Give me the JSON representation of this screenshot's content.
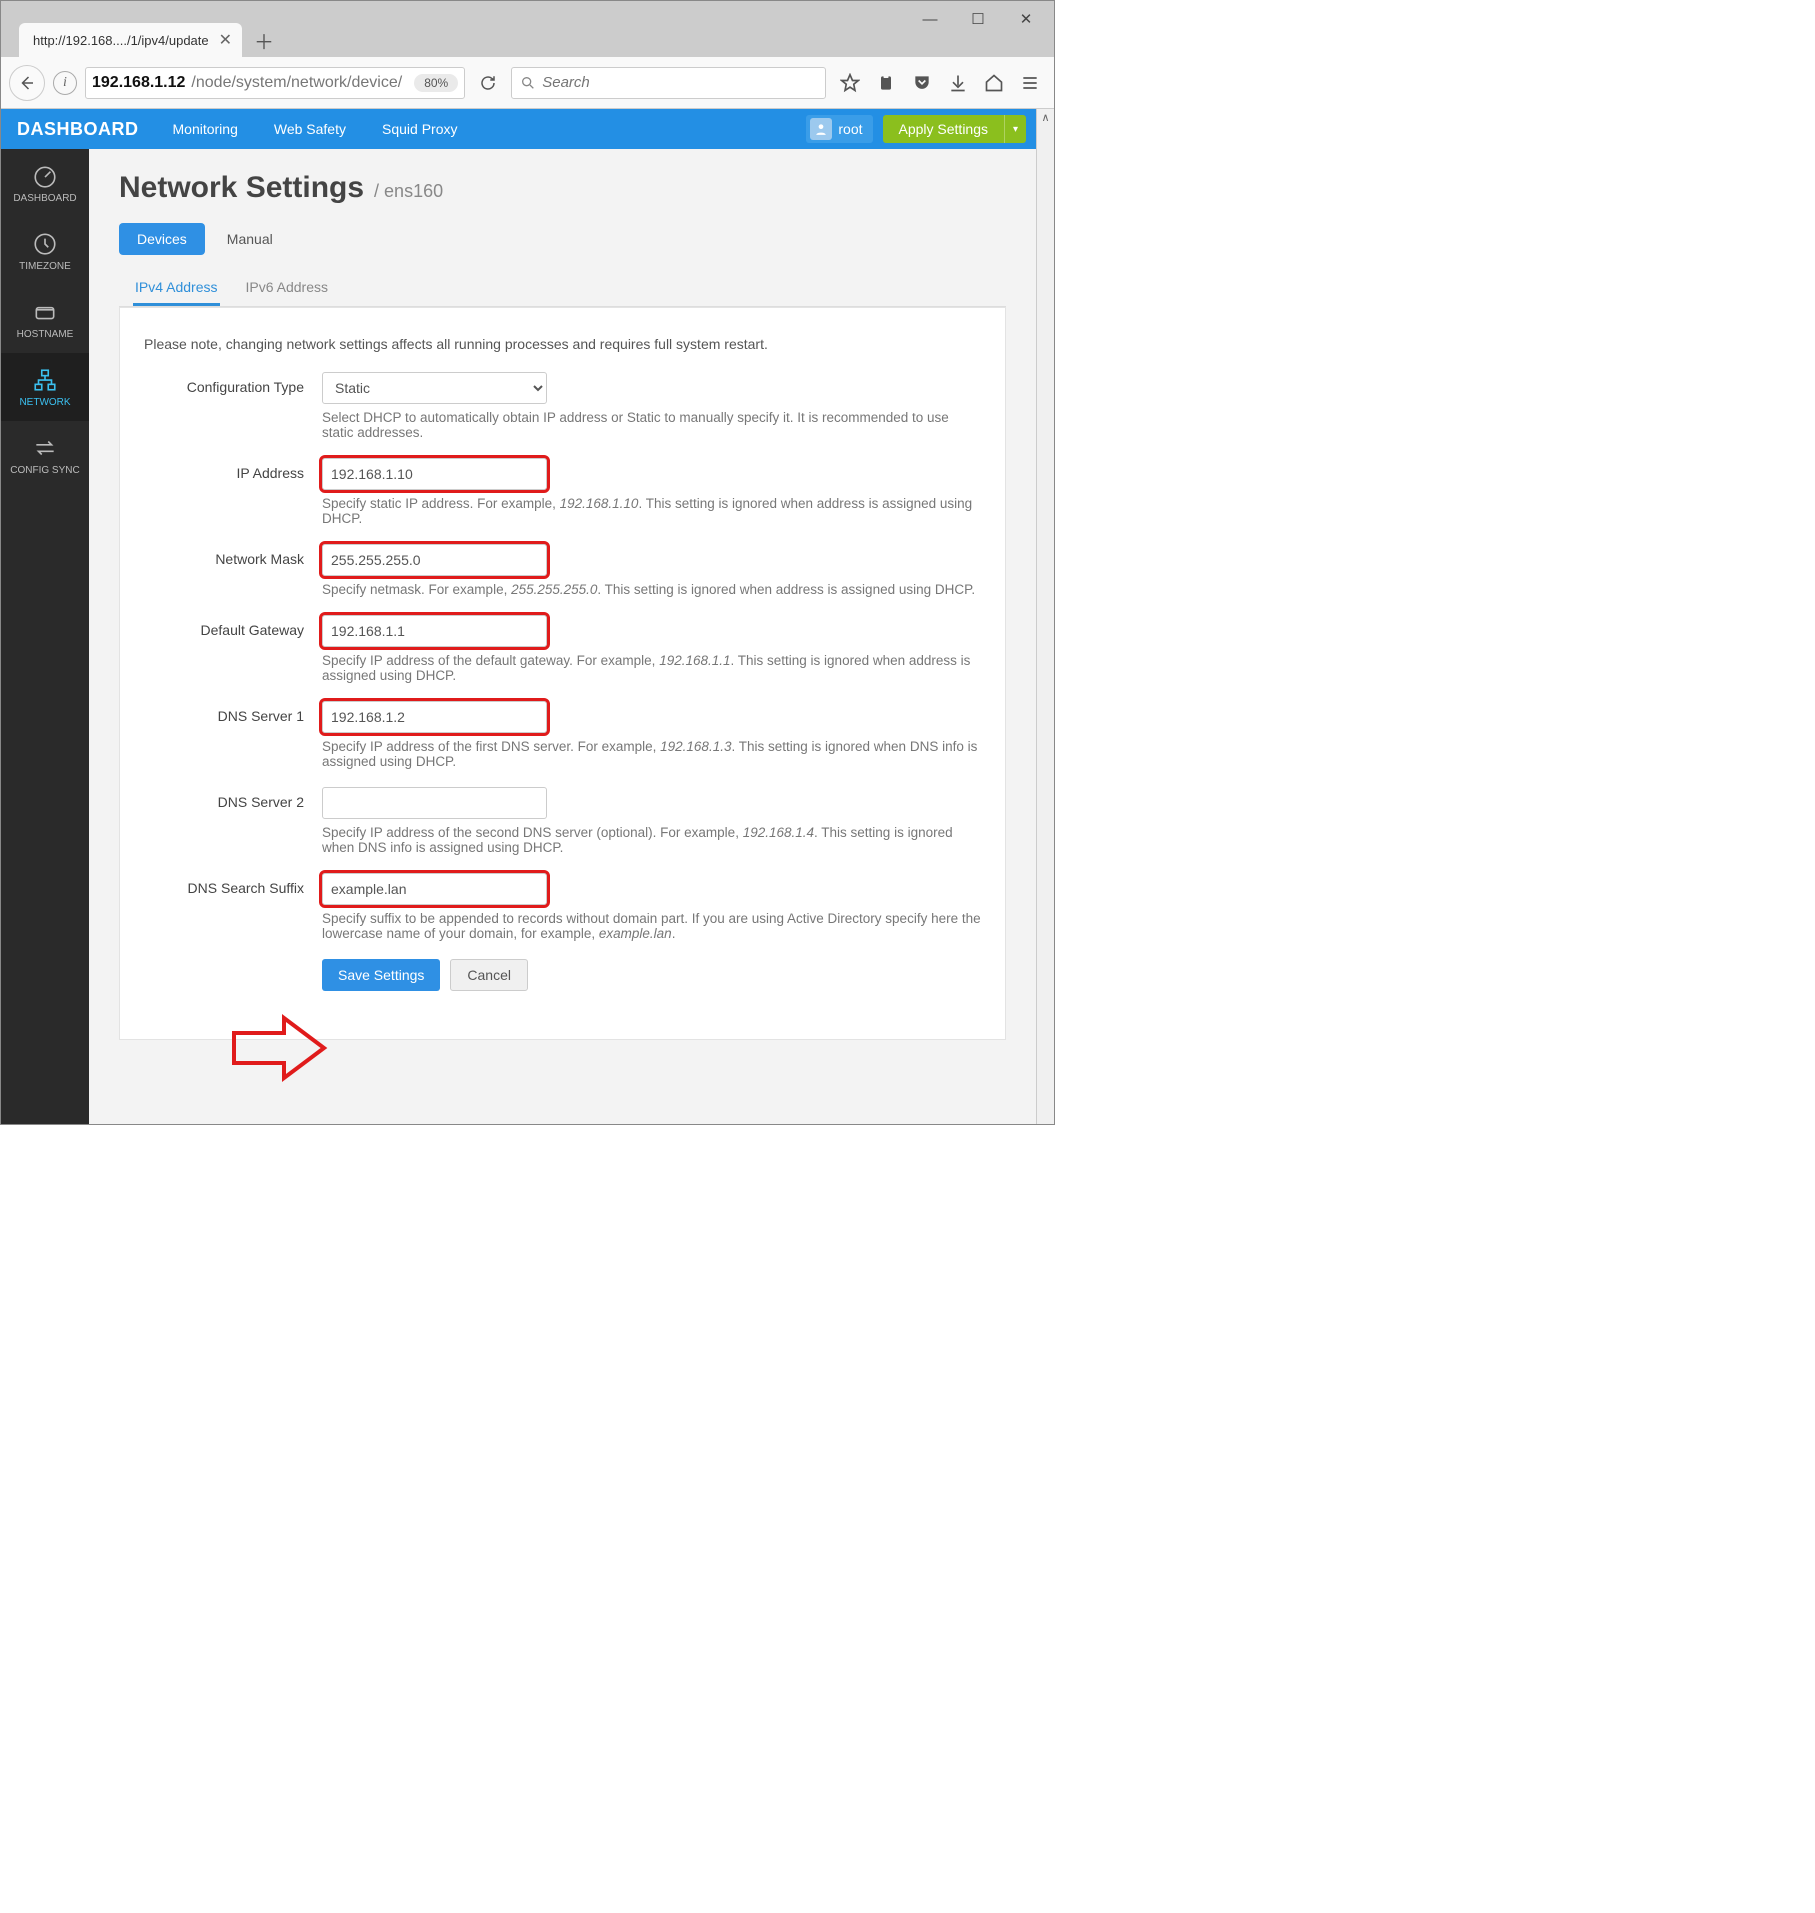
{
  "browser": {
    "tab_title": "http://192.168..../1/ipv4/update",
    "url_domain": "192.168.1.12",
    "url_path": "/node/system/network/device/",
    "zoom": "80%",
    "search_placeholder": "Search"
  },
  "header": {
    "brand": "DASHBOARD",
    "nav": [
      "Monitoring",
      "Web Safety",
      "Squid Proxy"
    ],
    "user": "root",
    "apply": "Apply Settings"
  },
  "sidebar": {
    "items": [
      {
        "label": "DASHBOARD"
      },
      {
        "label": "TIMEZONE"
      },
      {
        "label": "HOSTNAME"
      },
      {
        "label": "NETWORK"
      },
      {
        "label": "CONFIG SYNC"
      }
    ],
    "active_index": 3
  },
  "page": {
    "title": "Network Settings",
    "crumb": "/ ens160",
    "pill_tabs": [
      "Devices",
      "Manual"
    ],
    "pill_active": 0,
    "line_tabs": [
      "IPv4 Address",
      "IPv6 Address"
    ],
    "line_active": 0,
    "note": "Please note, changing network settings affects all running processes and requires full system restart."
  },
  "form": {
    "config_type": {
      "label": "Configuration Type",
      "value": "Static",
      "help": "Select DHCP to automatically obtain IP address or Static to manually specify it. It is recommended to use static addresses."
    },
    "ip": {
      "label": "IP Address",
      "value": "192.168.1.10",
      "help_pre": "Specify static IP address. For example, ",
      "help_em": "192.168.1.10",
      "help_post": ". This setting is ignored when address is assigned using DHCP."
    },
    "mask": {
      "label": "Network Mask",
      "value": "255.255.255.0",
      "help_pre": "Specify netmask. For example, ",
      "help_em": "255.255.255.0",
      "help_post": ". This setting is ignored when address is assigned using DHCP."
    },
    "gw": {
      "label": "Default Gateway",
      "value": "192.168.1.1",
      "help_pre": "Specify IP address of the default gateway. For example, ",
      "help_em": "192.168.1.1",
      "help_post": ". This setting is ignored when address is assigned using DHCP."
    },
    "dns1": {
      "label": "DNS Server 1",
      "value": "192.168.1.2",
      "help_pre": "Specify IP address of the first DNS server. For example, ",
      "help_em": "192.168.1.3",
      "help_post": ". This setting is ignored when DNS info is assigned using DHCP."
    },
    "dns2": {
      "label": "DNS Server 2",
      "value": "",
      "help_pre": "Specify IP address of the second DNS server (optional). For example, ",
      "help_em": "192.168.1.4",
      "help_post": ". This setting is ignored when DNS info is assigned using DHCP."
    },
    "suffix": {
      "label": "DNS Search Suffix",
      "value": "example.lan",
      "help_pre": "Specify suffix to be appended to records without domain part. If you are using Active Directory specify here the lowercase name of your domain, for example, ",
      "help_em": "example.lan",
      "help_post": "."
    },
    "save": "Save Settings",
    "cancel": "Cancel"
  }
}
